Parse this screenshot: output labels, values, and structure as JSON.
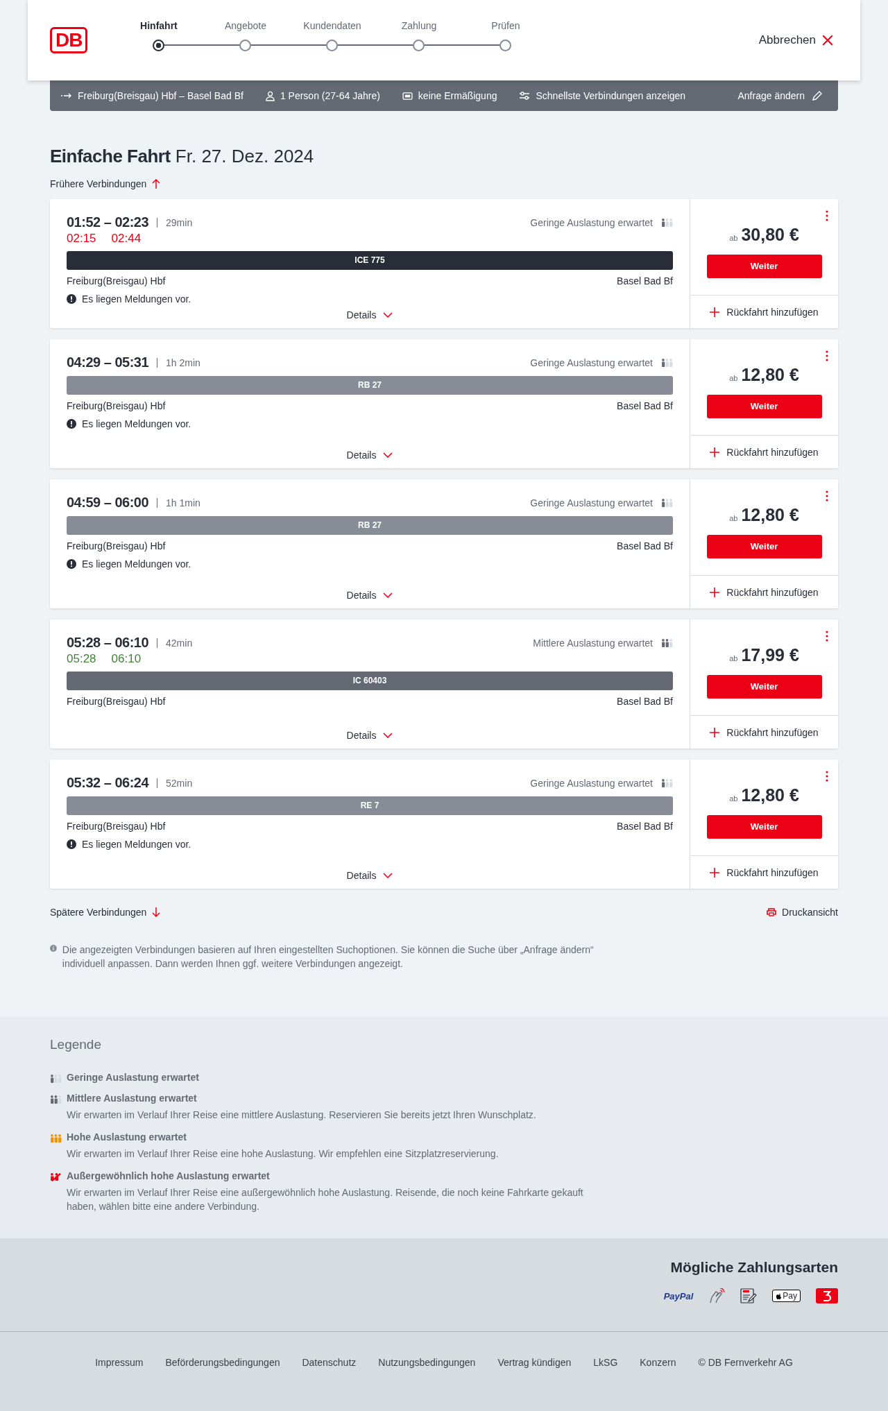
{
  "header": {
    "logo": "DB",
    "steps": [
      {
        "label": "Hinfahrt",
        "selected": true
      },
      {
        "label": "Angebote",
        "selected": false
      },
      {
        "label": "Kundendaten",
        "selected": false
      },
      {
        "label": "Zahlung",
        "selected": false
      },
      {
        "label": "Prüfen",
        "selected": false
      }
    ],
    "cancel": "Abbrechen"
  },
  "query_bar": {
    "route": "Freiburg(Breisgau) Hbf – Basel Bad Bf",
    "travellers": "1 Person (27-64 Jahre)",
    "discount": "keine Ermäßigung",
    "option": "Schnellste Verbindungen anzeigen",
    "edit": "Anfrage ändern"
  },
  "title": "Einfache Fahrt",
  "date": "Fr. 27. Dez. 2024",
  "earlier": "Frühere Verbindungen",
  "connections": [
    {
      "times": "01:52 – 02:23",
      "duration": "29min",
      "realtime": {
        "departure": "02:15",
        "arrival": "02:44",
        "kind": "delayed"
      },
      "occupancy": {
        "label": "Geringe Auslastung erwartet",
        "kind": "low"
      },
      "train": "ICE 775",
      "color": "#282d37",
      "from": "Freiburg(Breisgau) Hbf",
      "to": "Basel Bad Bf",
      "notice": "Es liegen Meldungen vor.",
      "details": "Details",
      "price_prefix": "ab",
      "price": "30,80 €",
      "button": "Weiter",
      "return": "Rückfahrt hinzufügen"
    },
    {
      "times": "04:29 – 05:31",
      "duration": "1h 2min",
      "occupancy": {
        "label": "Geringe Auslastung erwartet",
        "kind": "low"
      },
      "train": "RB 27",
      "color": "#878c96",
      "from": "Freiburg(Breisgau) Hbf",
      "to": "Basel Bad Bf",
      "notice": "Es liegen Meldungen vor.",
      "details": "Details",
      "price_prefix": "ab",
      "price": "12,80 €",
      "button": "Weiter",
      "return": "Rückfahrt hinzufügen"
    },
    {
      "times": "04:59 – 06:00",
      "duration": "1h 1min",
      "occupancy": {
        "label": "Geringe Auslastung erwartet",
        "kind": "low"
      },
      "train": "RB 27",
      "color": "#878c96",
      "from": "Freiburg(Breisgau) Hbf",
      "to": "Basel Bad Bf",
      "notice": "Es liegen Meldungen vor.",
      "details": "Details",
      "price_prefix": "ab",
      "price": "12,80 €",
      "button": "Weiter",
      "return": "Rückfahrt hinzufügen"
    },
    {
      "times": "05:28 – 06:10",
      "duration": "42min",
      "realtime": {
        "departure": "05:28",
        "arrival": "06:10",
        "kind": "on_time"
      },
      "occupancy": {
        "label": "Mittlere Auslastung erwartet",
        "kind": "medium"
      },
      "train": "IC 60403",
      "color": "#646973",
      "from": "Freiburg(Breisgau) Hbf",
      "to": "Basel Bad Bf",
      "details": "Details",
      "price_prefix": "ab",
      "price": "17,99 €",
      "button": "Weiter",
      "return": "Rückfahrt hinzufügen"
    },
    {
      "times": "05:32 – 06:24",
      "duration": "52min",
      "occupancy": {
        "label": "Geringe Auslastung erwartet",
        "kind": "low"
      },
      "train": "RE 7",
      "color": "#878c96",
      "from": "Freiburg(Breisgau) Hbf",
      "to": "Basel Bad Bf",
      "notice": "Es liegen Meldungen vor.",
      "details": "Details",
      "price_prefix": "ab",
      "price": "12,80 €",
      "button": "Weiter",
      "return": "Rückfahrt hinzufügen"
    }
  ],
  "later": "Spätere Verbindungen",
  "print": "Druckansicht",
  "info": "Die angezeigten Verbindungen basieren auf Ihren eingestellten Suchoptionen. Sie können die Suche über „Anfrage ändern“ individuell anpassen. Dann werden Ihnen ggf. weitere Verbindungen angezeigt.",
  "legend": {
    "title": "Legende",
    "items": [
      {
        "kind": "low",
        "label": "Geringe Auslastung erwartet"
      },
      {
        "kind": "medium",
        "label": "Mittlere Auslastung erwartet",
        "text": "Wir erwarten im Verlauf Ihrer Reise eine mittlere Auslastung. Reservieren Sie bereits jetzt Ihren Wunschplatz."
      },
      {
        "kind": "high",
        "label": "Hohe Auslastung erwartet",
        "text": "Wir erwarten im Verlauf Ihrer Reise eine hohe Auslastung. Wir empfehlen eine Sitzplatzreservierung."
      },
      {
        "kind": "exceptional",
        "label": "Außergewöhnlich hohe Auslastung erwartet",
        "text": "Wir erwarten im Verlauf Ihrer Reise eine außergewöhnlich hohe Auslastung. Reisende, die noch keine Fahrkarte gekauft haben, wählen bitte eine andere Verbindung."
      }
    ]
  },
  "payment": {
    "title": "Mögliche Zahlungsarten",
    "paypal": "PayPal",
    "applepay": "Pay"
  },
  "footer": [
    "Impressum",
    "Beförderungsbedingungen",
    "Datenschutz",
    "Nutzungsbedingungen",
    "Vertrag kündigen",
    "LkSG",
    "Konzern",
    "© DB Fernverkehr AG"
  ]
}
